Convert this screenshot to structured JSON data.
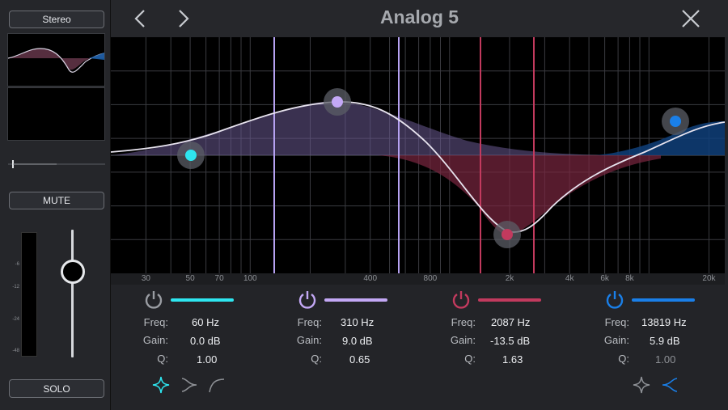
{
  "app": {
    "title": "Analog 5"
  },
  "sidebar": {
    "stereo_label": "Stereo",
    "mute_label": "MUTE",
    "solo_label": "SOLO",
    "meter_labels": [
      "-6",
      "-12",
      "-24",
      "-48"
    ]
  },
  "graph": {
    "freq_axis": {
      "labels": [
        "30",
        "50",
        "70",
        "100",
        "400",
        "800",
        "2k",
        "4k",
        "6k",
        "8k",
        "20k"
      ],
      "values": [
        30,
        50,
        70,
        100,
        400,
        800,
        2000,
        4000,
        6000,
        8000,
        20000
      ]
    },
    "gain_range_db": [
      -24,
      24
    ]
  },
  "bands": [
    {
      "name": "band-1",
      "color": "#2ee6f0",
      "freq_label": "Freq:",
      "freq": "60 Hz",
      "gain_label": "Gain:",
      "gain": "0.0 dB",
      "q_label": "Q:",
      "q": "1.00",
      "enabled": true
    },
    {
      "name": "band-2",
      "color": "#c3a8f5",
      "freq_label": "Freq:",
      "freq": "310 Hz",
      "gain_label": "Gain:",
      "gain": "9.0 dB",
      "q_label": "Q:",
      "q": "0.65",
      "enabled": true
    },
    {
      "name": "band-3",
      "color": "#c23a5e",
      "freq_label": "Freq:",
      "freq": "2087 Hz",
      "gain_label": "Gain:",
      "gain": "-13.5 dB",
      "q_label": "Q:",
      "q": "1.63",
      "enabled": true
    },
    {
      "name": "band-4",
      "color": "#1a7fe8",
      "freq_label": "Freq:",
      "freq": "13819 Hz",
      "gain_label": "Gain:",
      "gain": "5.9 dB",
      "q_label": "Q:",
      "q": "1.00",
      "enabled": true
    }
  ],
  "colors": {
    "accent_cyan": "#2ee6f0",
    "accent_blue": "#1a7fe8",
    "curve": "#e8e4ef"
  },
  "icons": {
    "back": "chevron-left-icon",
    "forward": "chevron-right-icon",
    "close": "close-icon",
    "power": "power-icon",
    "bell": "bell-shape-icon",
    "low_shelf": "low-shelf-icon",
    "low_cut": "low-cut-icon",
    "high_shelf": "high-shelf-icon"
  }
}
